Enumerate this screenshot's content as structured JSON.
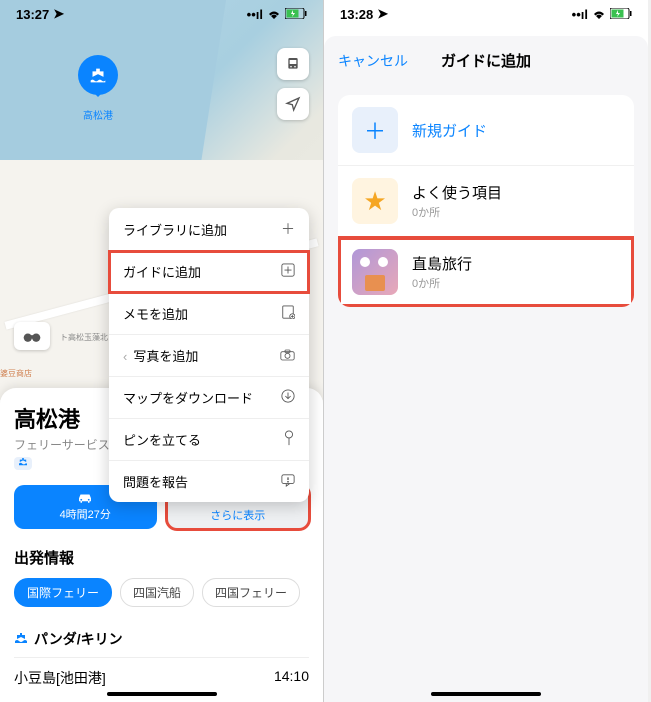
{
  "left": {
    "status": {
      "time": "13:27",
      "location_icon": "▸"
    },
    "map_pin": {
      "label": "高松港"
    },
    "menu": {
      "items": [
        {
          "label": "ライブラリに追加",
          "icon": "＋"
        },
        {
          "label": "ガイドに追加",
          "icon": "⊕",
          "highlight": true
        },
        {
          "label": "メモを追加",
          "icon": "📋"
        },
        {
          "label": "写真を追加",
          "icon": "📷",
          "chevron": "‹"
        },
        {
          "label": "マップをダウンロード",
          "icon": "⬇"
        },
        {
          "label": "ピンを立てる",
          "icon": "📍"
        },
        {
          "label": "問題を報告",
          "icon": "⚑"
        }
      ]
    },
    "place": {
      "title": "高松港",
      "subtitle": "フェリーサービス",
      "badge": "⛴"
    },
    "actions": {
      "drive": {
        "time": "4時間27分"
      },
      "more": {
        "dots": "•••",
        "label": "さらに表示"
      }
    },
    "departures": {
      "title": "出発情報",
      "chips": [
        "国際フェリー",
        "四国汽船",
        "四国フェリー"
      ],
      "ferry_name": "パンダ/キリン",
      "dest": "小豆島[池田港]",
      "time": "14:10"
    }
  },
  "right": {
    "status": {
      "time": "13:28"
    },
    "modal": {
      "cancel": "キャンセル",
      "title": "ガイドに追加",
      "items": [
        {
          "name": "新規ガイド",
          "type": "plus"
        },
        {
          "name": "よく使う項目",
          "count": "0か所",
          "type": "star"
        },
        {
          "name": "直島旅行",
          "count": "0か所",
          "type": "img",
          "highlight": true
        }
      ]
    }
  }
}
